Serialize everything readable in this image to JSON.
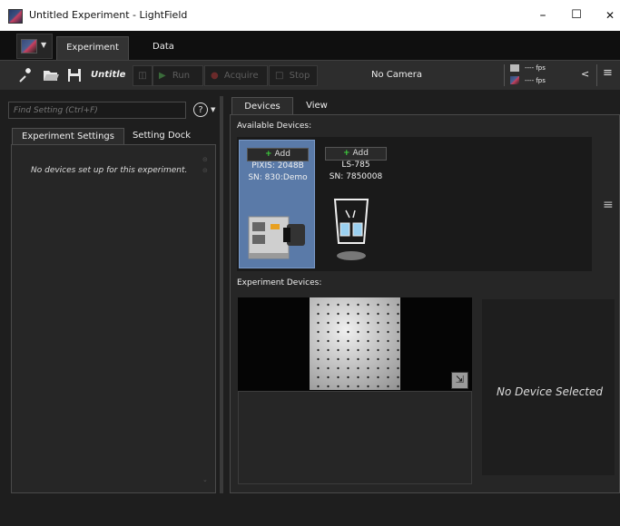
{
  "window": {
    "title": "Untitled Experiment - LightField",
    "minimize_glyph": "–",
    "maximize_glyph": "☐",
    "close_glyph": "✕"
  },
  "tabs": {
    "experiment": "Experiment",
    "data": "Data"
  },
  "toolbar": {
    "experiment_name": "Untitle",
    "run_label": "Run",
    "acquire_label": "Acquire",
    "stop_label": "Stop",
    "camera_label": "No Camera",
    "fps_top": "---- fps",
    "fps_bottom": "---- fps",
    "chevron": "<",
    "menu_glyph": "≡"
  },
  "left_panel": {
    "find_placeholder": "Find Setting (Ctrl+F)",
    "help_glyph": "?",
    "tabs": [
      "Experiment Settings",
      "Setting Dock"
    ],
    "empty_message": "No devices set up for this experiment."
  },
  "right_panel": {
    "tabs": [
      "Devices",
      "View"
    ],
    "available_label": "Available Devices:",
    "devices": [
      {
        "add_label": "Add",
        "name": "PIXIS: 2048B",
        "sn": "SN: 830:Demo",
        "icon": "camera-icon"
      },
      {
        "add_label": "Add",
        "name": "LS-785",
        "sn": "SN: 7850008",
        "icon": "spectrometer-icon"
      }
    ],
    "experiment_devices_label": "Experiment Devices:",
    "no_device_selected": "No Device Selected"
  },
  "colors": {
    "selected_card": "#5a7aa8",
    "add_plus": "#3ccf3c",
    "background": "#1e1e1e"
  }
}
